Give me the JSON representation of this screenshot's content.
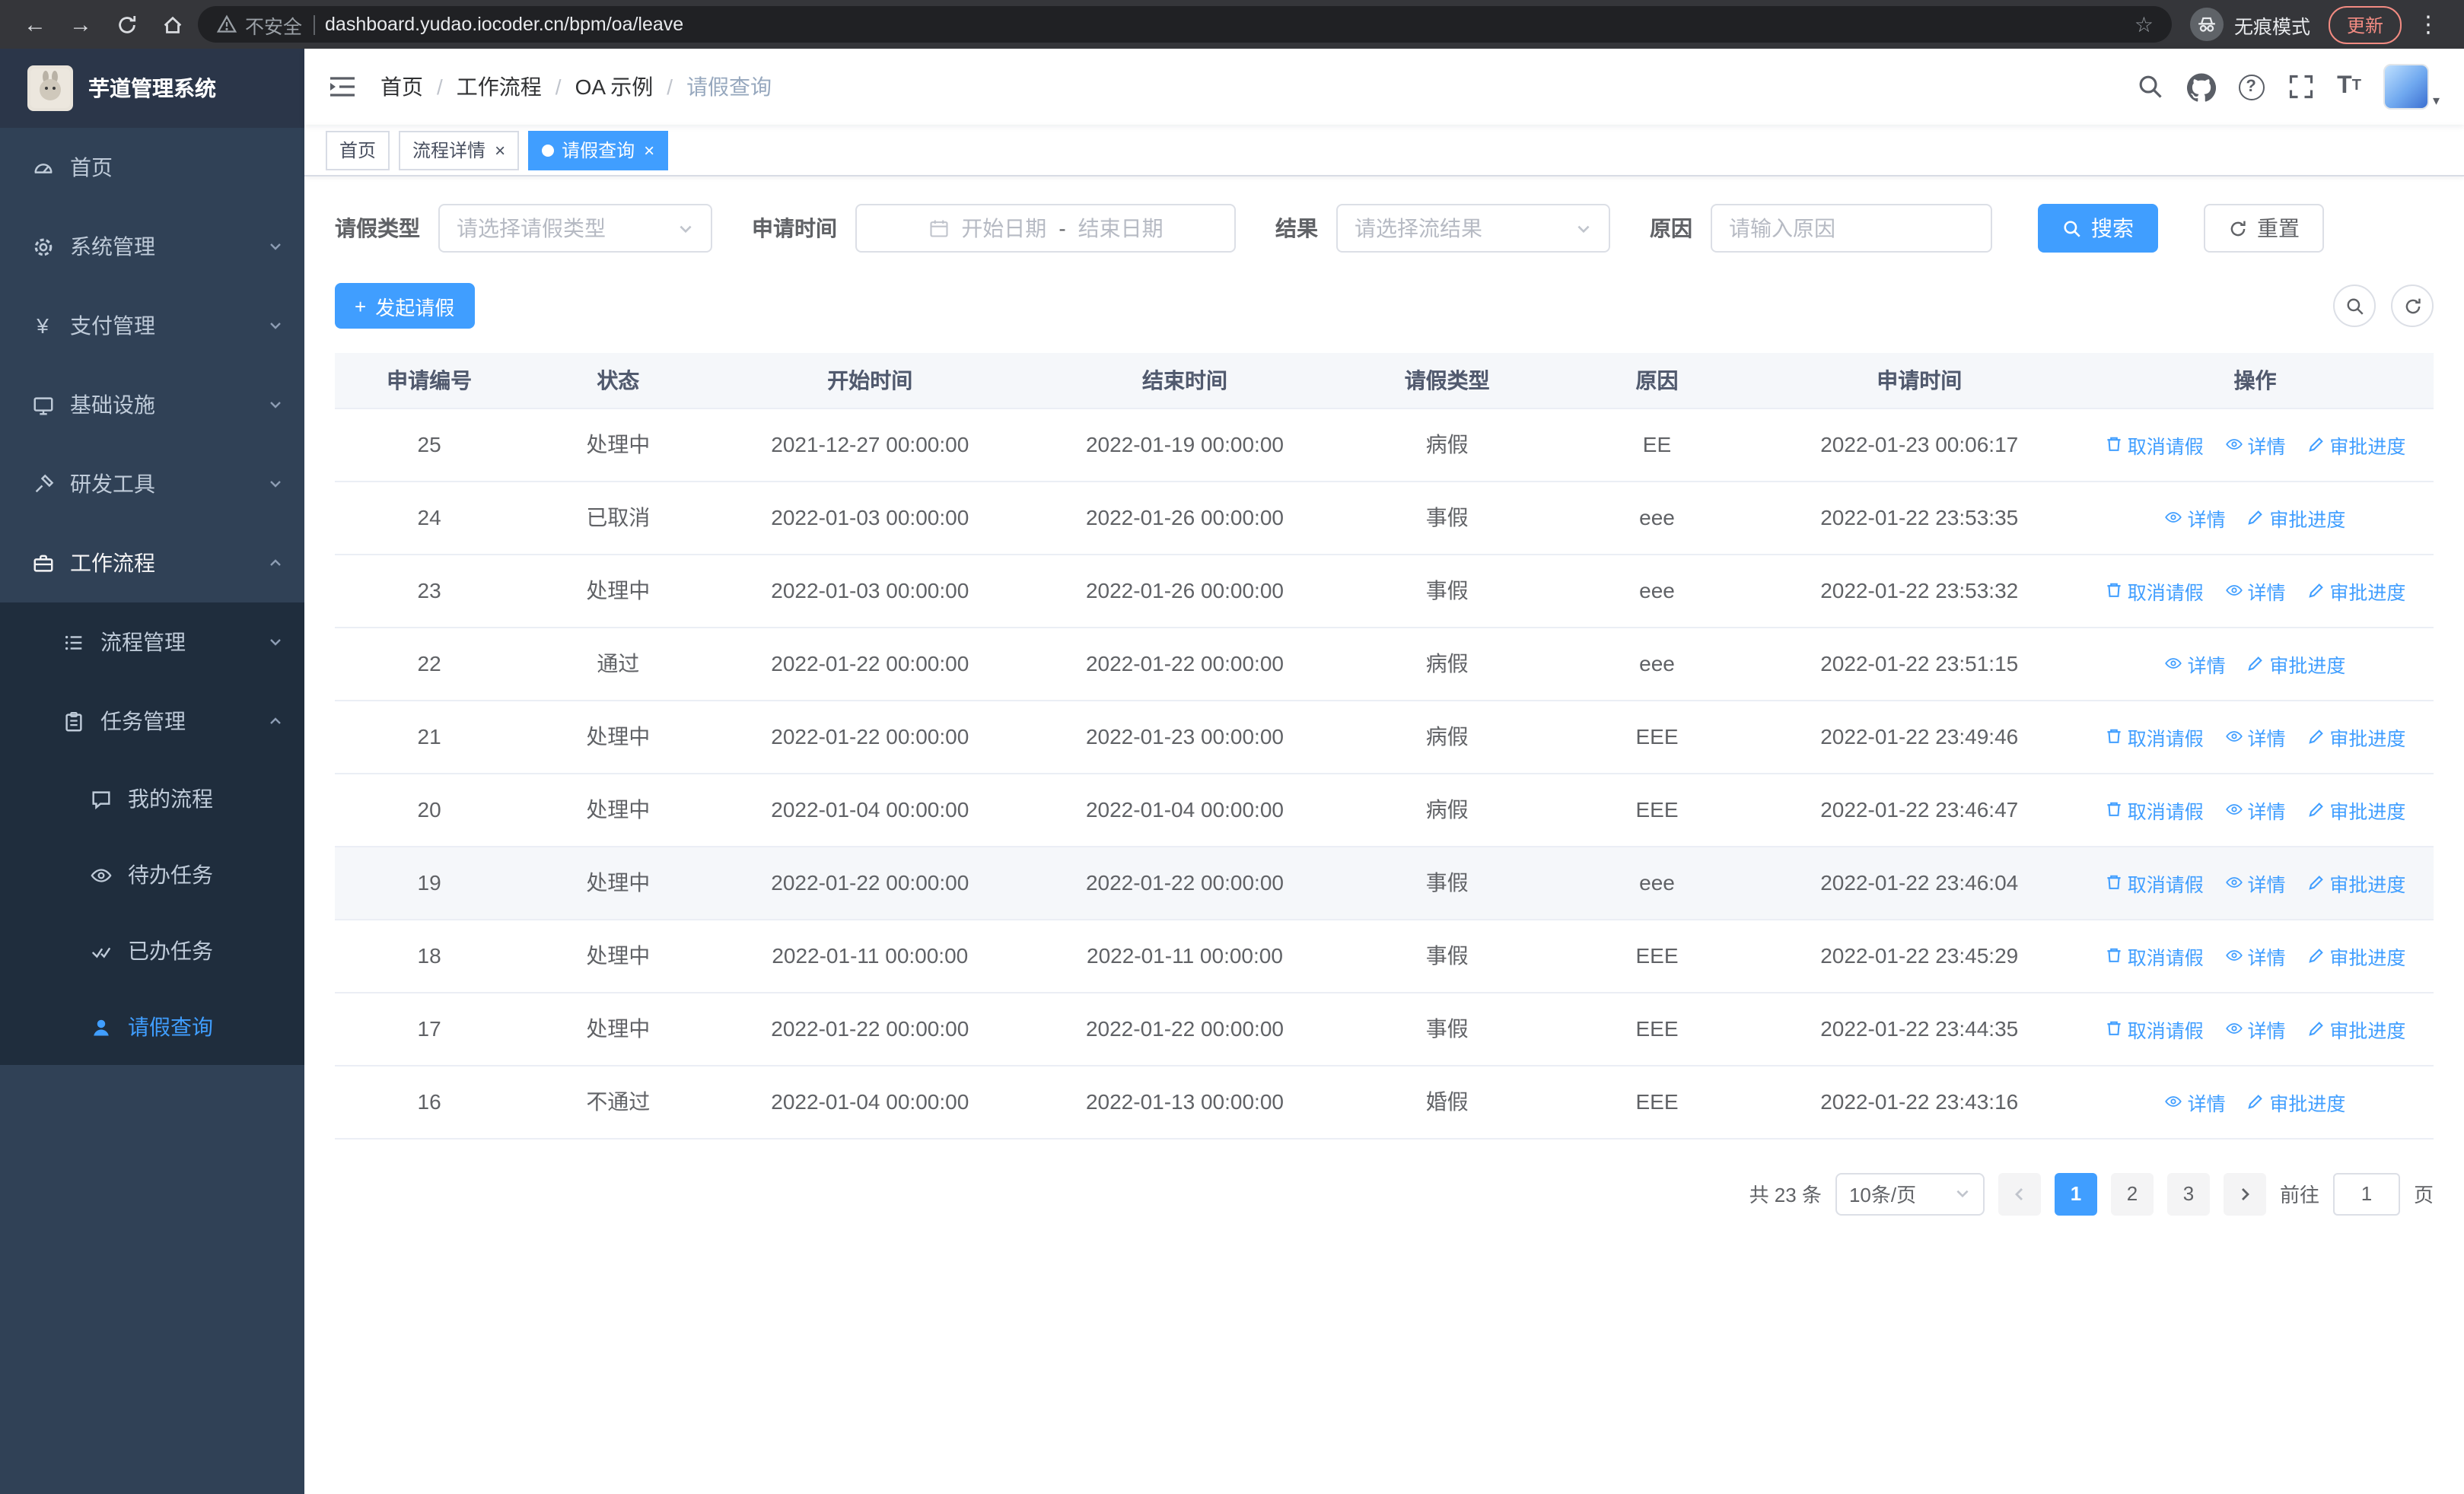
{
  "browser": {
    "url": "dashboard.yudao.iocoder.cn/bpm/oa/leave",
    "security_label": "不安全",
    "incognito_label": "无痕模式",
    "update_label": "更新"
  },
  "icons": {
    "back": "←",
    "forward": "→",
    "star": "☆",
    "menu_dots": "⋮",
    "yen": "¥",
    "question": "?",
    "font_large": "T",
    "font_small": "T",
    "plus": "+",
    "close": "×",
    "caret": "▾"
  },
  "sidebar": {
    "title": "芋道管理系统",
    "items": [
      "首页",
      "系统管理",
      "支付管理",
      "基础设施",
      "研发工具",
      "工作流程",
      "流程管理",
      "任务管理",
      "我的流程",
      "待办任务",
      "已办任务",
      "请假查询"
    ]
  },
  "navbar": {
    "breadcrumb": {
      "items": [
        "首页",
        "工作流程",
        "OA 示例",
        "请假查询"
      ],
      "separator": "/"
    }
  },
  "tabs": [
    {
      "label": "首页",
      "active": false,
      "closable": false
    },
    {
      "label": "流程详情",
      "active": false,
      "closable": true
    },
    {
      "label": "请假查询",
      "active": true,
      "closable": true
    }
  ],
  "filters": {
    "leave_type": {
      "label": "请假类型",
      "placeholder": "请选择请假类型"
    },
    "apply_time": {
      "label": "申请时间",
      "start_placeholder": "开始日期",
      "separator": "-",
      "end_placeholder": "结束日期"
    },
    "result": {
      "label": "结果",
      "placeholder": "请选择流结果"
    },
    "reason": {
      "label": "原因",
      "placeholder": "请输入原因"
    },
    "search_label": "搜索",
    "reset_label": "重置"
  },
  "toolbar": {
    "create_label": "发起请假"
  },
  "table": {
    "headers": [
      "申请编号",
      "状态",
      "开始时间",
      "结束时间",
      "请假类型",
      "原因",
      "申请时间",
      "操作"
    ],
    "action_labels": {
      "cancel": "取消请假",
      "detail": "详情",
      "progress": "审批进度"
    },
    "rows": [
      {
        "id": "25",
        "status": "处理中",
        "start": "2021-12-27 00:00:00",
        "end": "2022-01-19 00:00:00",
        "type": "病假",
        "reason": "EE",
        "applied": "2022-01-23 00:06:17",
        "cancellable": true,
        "highlighted": false
      },
      {
        "id": "24",
        "status": "已取消",
        "start": "2022-01-03 00:00:00",
        "end": "2022-01-26 00:00:00",
        "type": "事假",
        "reason": "eee",
        "applied": "2022-01-22 23:53:35",
        "cancellable": false,
        "highlighted": false
      },
      {
        "id": "23",
        "status": "处理中",
        "start": "2022-01-03 00:00:00",
        "end": "2022-01-26 00:00:00",
        "type": "事假",
        "reason": "eee",
        "applied": "2022-01-22 23:53:32",
        "cancellable": true,
        "highlighted": false
      },
      {
        "id": "22",
        "status": "通过",
        "start": "2022-01-22 00:00:00",
        "end": "2022-01-22 00:00:00",
        "type": "病假",
        "reason": "eee",
        "applied": "2022-01-22 23:51:15",
        "cancellable": false,
        "highlighted": false
      },
      {
        "id": "21",
        "status": "处理中",
        "start": "2022-01-22 00:00:00",
        "end": "2022-01-23 00:00:00",
        "type": "病假",
        "reason": "EEE",
        "applied": "2022-01-22 23:49:46",
        "cancellable": true,
        "highlighted": false
      },
      {
        "id": "20",
        "status": "处理中",
        "start": "2022-01-04 00:00:00",
        "end": "2022-01-04 00:00:00",
        "type": "病假",
        "reason": "EEE",
        "applied": "2022-01-22 23:46:47",
        "cancellable": true,
        "highlighted": false
      },
      {
        "id": "19",
        "status": "处理中",
        "start": "2022-01-22 00:00:00",
        "end": "2022-01-22 00:00:00",
        "type": "事假",
        "reason": "eee",
        "applied": "2022-01-22 23:46:04",
        "cancellable": true,
        "highlighted": true
      },
      {
        "id": "18",
        "status": "处理中",
        "start": "2022-01-11 00:00:00",
        "end": "2022-01-11 00:00:00",
        "type": "事假",
        "reason": "EEE",
        "applied": "2022-01-22 23:45:29",
        "cancellable": true,
        "highlighted": false
      },
      {
        "id": "17",
        "status": "处理中",
        "start": "2022-01-22 00:00:00",
        "end": "2022-01-22 00:00:00",
        "type": "事假",
        "reason": "EEE",
        "applied": "2022-01-22 23:44:35",
        "cancellable": true,
        "highlighted": false
      },
      {
        "id": "16",
        "status": "不通过",
        "start": "2022-01-04 00:00:00",
        "end": "2022-01-13 00:00:00",
        "type": "婚假",
        "reason": "EEE",
        "applied": "2022-01-22 23:43:16",
        "cancellable": false,
        "highlighted": false
      }
    ]
  },
  "pagination": {
    "total": "共 23 条",
    "page_size": "10条/页",
    "pages": [
      "1",
      "2",
      "3"
    ],
    "current": "1",
    "goto_label": "前往",
    "goto_value": "1",
    "goto_suffix": "页"
  },
  "colors": {
    "accent": "#409EFF",
    "sidebar_bg": "#304156",
    "submenu_bg": "#1f2d3d",
    "sidebar_text": "#bfcbd9"
  }
}
